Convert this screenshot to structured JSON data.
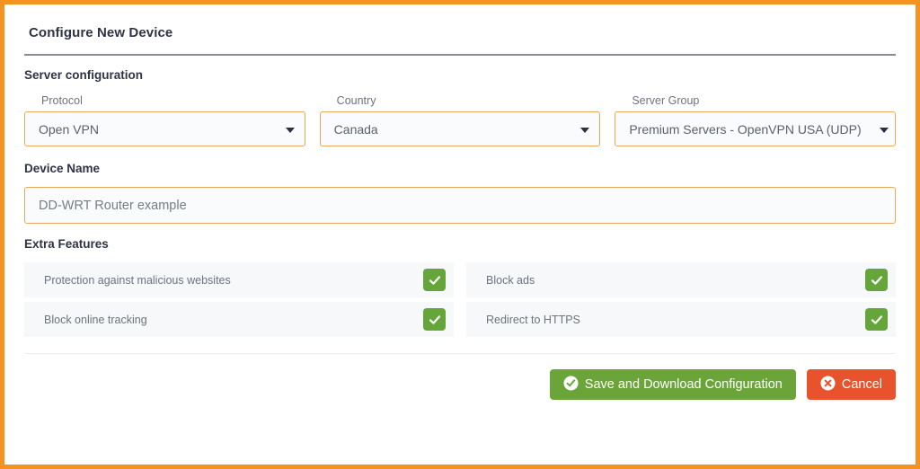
{
  "panel": {
    "title": "Configure New Device"
  },
  "server_configuration": {
    "heading": "Server configuration",
    "fields": [
      {
        "label": "Protocol",
        "value": "Open VPN",
        "icon": "chevron-down-icon"
      },
      {
        "label": "Country",
        "value": "Canada",
        "icon": "chevron-down-icon"
      },
      {
        "label": "Server Group",
        "value": "Premium Servers - OpenVPN USA (UDP)",
        "icon": "chevron-down-icon"
      }
    ]
  },
  "device_name": {
    "heading": "Device Name",
    "value": "DD-WRT Router example",
    "placeholder": "DD-WRT Router example"
  },
  "extra_features": {
    "heading": "Extra Features",
    "items": [
      {
        "label": "Protection against malicious websites",
        "checked": true
      },
      {
        "label": "Block ads",
        "checked": true
      },
      {
        "label": "Block online tracking",
        "checked": true
      },
      {
        "label": "Redirect to HTTPS",
        "checked": true
      }
    ]
  },
  "actions": {
    "save_label": "Save and Download Configuration",
    "save_icon": "check-circle-icon",
    "cancel_label": "Cancel",
    "cancel_icon": "times-circle-icon"
  },
  "colors": {
    "frame_border": "#f59322",
    "field_border": "#e8a85c",
    "checkbox_green": "#66a53a",
    "save_green": "#6ba539",
    "cancel_red": "#e8522d",
    "heading_text": "#2d3446",
    "label_text": "#6c737f",
    "row_background": "#f7f8f9"
  }
}
